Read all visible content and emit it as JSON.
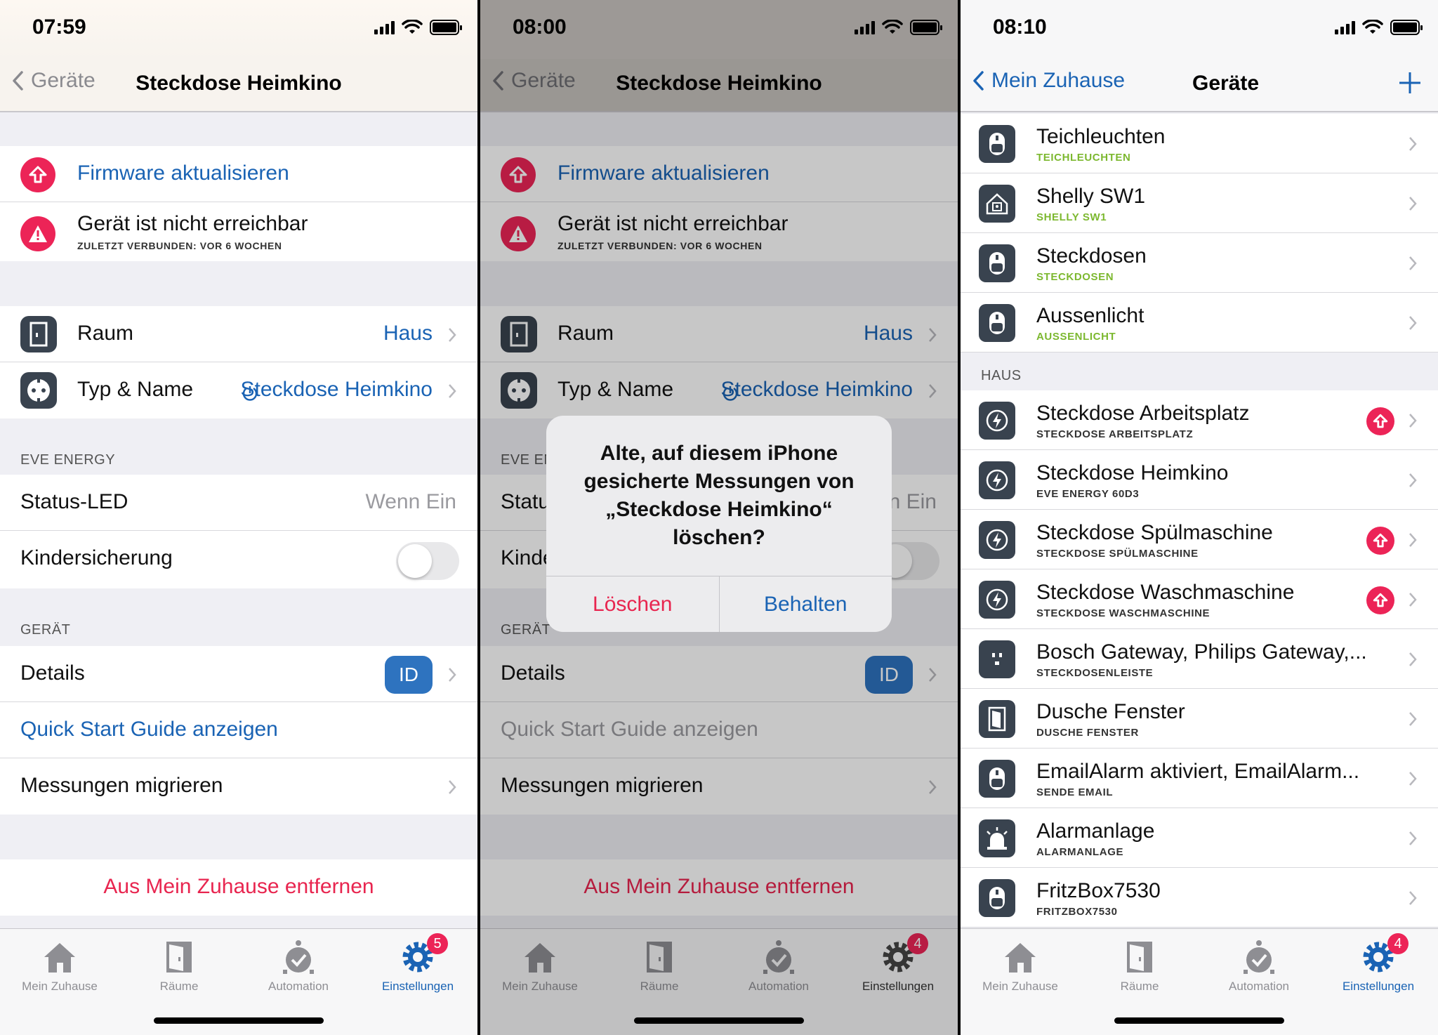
{
  "screens": [
    {
      "time": "07:59",
      "nav_back": "Geräte",
      "nav_title": "Steckdose Heimkino",
      "firmware_label": "Firmware aktualisieren",
      "unreachable_label": "Gerät ist nicht erreichbar",
      "unreachable_sub": "ZULETZT VERBUNDEN: VOR 6 WOCHEN",
      "room_label": "Raum",
      "room_value": "Haus",
      "type_label": "Typ & Name",
      "type_value": "Steckdose Heimkino",
      "section_eve": "EVE ENERGY",
      "status_led_label": "Status-LED",
      "status_led_value": "Wenn Ein",
      "child_lock_label": "Kindersicherung",
      "section_device": "GERÄT",
      "details_label": "Details",
      "details_badge": "ID",
      "quick_start_label": "Quick Start Guide anzeigen",
      "migrate_label": "Messungen migrieren",
      "remove_label": "Aus Mein Zuhause entfernen",
      "tabs": [
        "Mein Zuhause",
        "Räume",
        "Automation",
        "Einstellungen"
      ],
      "settings_badge": "5"
    },
    {
      "time": "08:00",
      "nav_back": "Geräte",
      "nav_title": "Steckdose Heimkino",
      "firmware_label": "Firmware aktualisieren",
      "unreachable_label": "Gerät ist nicht erreichbar",
      "unreachable_sub": "ZULETZT VERBUNDEN: VOR 6 WOCHEN",
      "room_label": "Raum",
      "room_value": "Haus",
      "type_label": "Typ & Name",
      "type_value": "Steckdose Heimkino",
      "section_eve": "EVE EN",
      "status_led_label": "Statu",
      "status_led_value": "n Ein",
      "child_lock_label": "Kinde",
      "section_device": "GERÄT",
      "details_label": "Details",
      "details_badge": "ID",
      "quick_start_label": "Quick Start Guide anzeigen",
      "migrate_label": "Messungen migrieren",
      "remove_label": "Aus Mein Zuhause entfernen",
      "tabs": [
        "Mein Zuhause",
        "Räume",
        "Automation",
        "Einstellungen"
      ],
      "settings_badge": "4",
      "alert": {
        "message": "Alte, auf diesem iPhone gesicherte Messungen von „Steckdose Heimkino“ löschen?",
        "delete_label": "Löschen",
        "keep_label": "Behalten"
      }
    },
    {
      "time": "08:10",
      "nav_back": "Mein Zuhause",
      "nav_title": "Geräte",
      "section_haus": "HAUS",
      "devices_top": [
        {
          "name": "Teichleuchten",
          "sub": "TEICHLEUCHTEN",
          "icon": "outlet-icon"
        },
        {
          "name": "Shelly SW1",
          "sub": "SHELLY SW1",
          "icon": "house-icon"
        },
        {
          "name": "Steckdosen",
          "sub": "STECKDOSEN",
          "icon": "outlet-icon"
        },
        {
          "name": "Aussenlicht",
          "sub": "AUSSENLICHT",
          "icon": "outlet-icon"
        }
      ],
      "devices_haus": [
        {
          "name": "Steckdose Arbeitsplatz",
          "sub": "STECKDOSE ARBEITSPLATZ",
          "icon": "energy-icon",
          "update": true
        },
        {
          "name": "Steckdose Heimkino",
          "sub": "EVE ENERGY 60D3",
          "icon": "energy-icon",
          "update": false
        },
        {
          "name": "Steckdose Spülmaschine",
          "sub": "STECKDOSE SPÜLMASCHINE",
          "icon": "energy-icon",
          "update": true
        },
        {
          "name": "Steckdose Waschmaschine",
          "sub": "STECKDOSE WASCHMASCHINE",
          "icon": "energy-icon",
          "update": true
        },
        {
          "name": "Bosch Gateway, Philips Gateway,...",
          "sub": "STECKDOSENLEISTE",
          "icon": "powerstrip-icon",
          "update": false
        },
        {
          "name": "Dusche Fenster",
          "sub": "DUSCHE FENSTER",
          "icon": "window-icon",
          "update": false
        },
        {
          "name": "EmailAlarm aktiviert, EmailAlarm...",
          "sub": "SENDE EMAIL",
          "icon": "outlet-icon",
          "update": false
        },
        {
          "name": "Alarmanlage",
          "sub": "ALARMANLAGE",
          "icon": "siren-icon",
          "update": false
        },
        {
          "name": "FritzBox7530",
          "sub": "FRITZBOX7530",
          "icon": "outlet-icon",
          "update": false
        }
      ],
      "tabs": [
        "Mein Zuhause",
        "Räume",
        "Automation",
        "Einstellungen"
      ],
      "settings_badge": "4"
    }
  ],
  "colors": {
    "accent_blue": "#1a63b4",
    "destructive_red": "#e8254f",
    "update_pink": "#ec2457",
    "icon_dark": "#39434f",
    "green_sub": "#7cb82f"
  }
}
